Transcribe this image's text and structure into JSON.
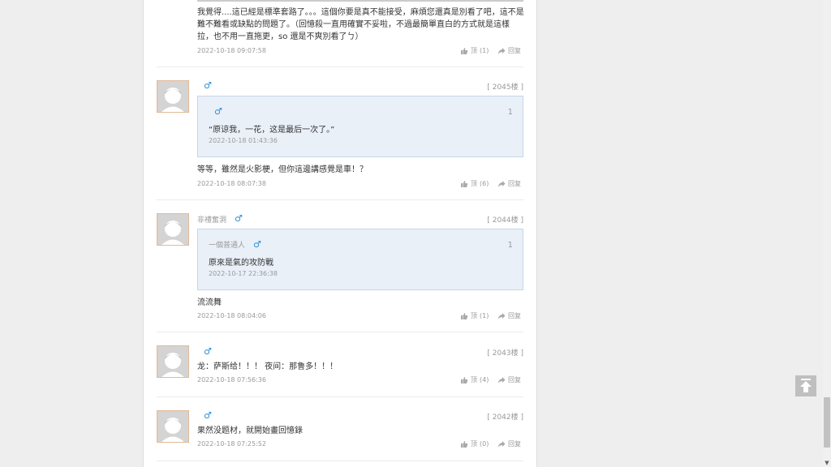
{
  "actions": {
    "like_prefix": "顶",
    "reply_label": "回复"
  },
  "comments": [
    {
      "text": "我覺得....這已經是標準套路了。。。這個你要是真不能接受，麻煩您還真是別看了吧，這不是難不難看或缺點的問題了。（回憶殺一直用確實不妥啦，不過最簡單直白的方式就是這樣拉，也不用一直拖更，so 還是不爽別看了ㄅ）",
      "time": "2022-10-18 09:07:58",
      "likes": "(1)"
    },
    {
      "gender": "♂",
      "floor": "[ 2045楼 ]",
      "quote": {
        "num": "1",
        "gender": "♂",
        "text": "“原谅我，一花，这是最后一次了。”",
        "time": "2022-10-18 01:43:36"
      },
      "text": "等等，雖然是火影梗，但你這邊講感覺是車！？",
      "time": "2022-10-18 08:07:38",
      "likes": "(6)"
    },
    {
      "username": "非禮奮洞",
      "gender": "♂",
      "floor": "[ 2044楼 ]",
      "quote": {
        "user": "一個普通人",
        "num": "1",
        "gender": "♂",
        "text": "原來是氣的攻防戰",
        "time": "2022-10-17 22:36:38"
      },
      "text": "流流舞",
      "time": "2022-10-18 08:04:06",
      "likes": "(1)"
    },
    {
      "gender": "♂",
      "floor": "[ 2043楼 ]",
      "text": "龙：萨斯给！！！ 夜间：那鲁多！！！",
      "time": "2022-10-18 07:56:36",
      "likes": "(4)"
    },
    {
      "gender": "♂",
      "floor": "[ 2042楼 ]",
      "text": "果然没题材，就開始畫回憶錄",
      "time": "2022-10-18 07:25:52",
      "likes": "(0)"
    }
  ],
  "colors": {
    "male": "#2a8fd6",
    "accent_border": "#e2b995",
    "quote_bg": "#eaf0f8"
  },
  "icons": {
    "like": "thumb-up-icon",
    "reply": "share-arrow-icon",
    "to_top": "arrow-up-icon"
  }
}
